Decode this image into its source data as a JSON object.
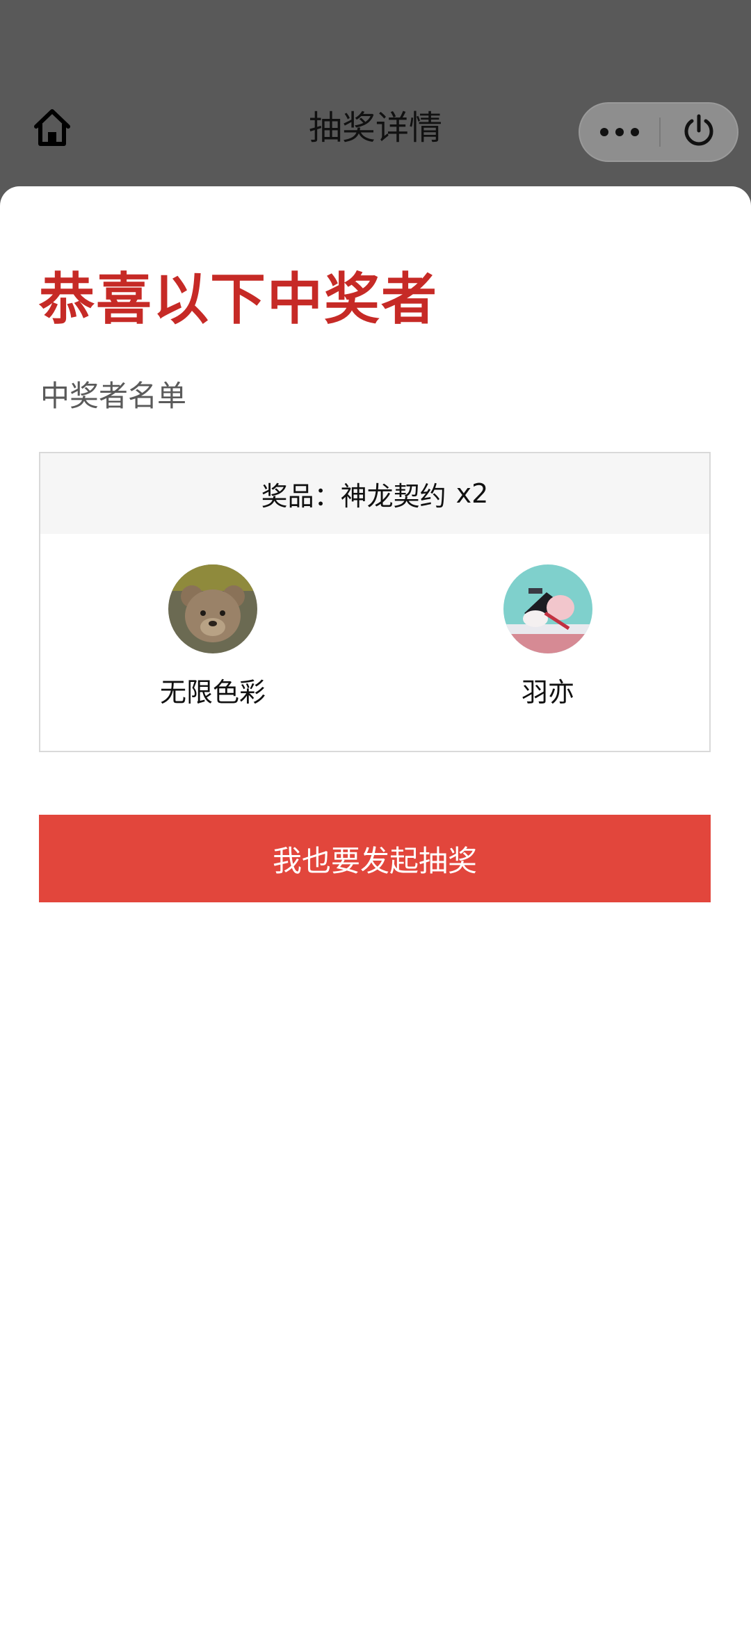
{
  "navbar": {
    "title": "抽奖详情",
    "home_icon": "home-icon",
    "more_icon": "more-dots-icon",
    "close_icon": "power-icon"
  },
  "main": {
    "headline": "恭喜以下中奖者",
    "section_label": "中奖者名单",
    "prize": {
      "label": "奖品：",
      "name": "神龙契约",
      "quantity": "x2",
      "winners": [
        {
          "name": "无限色彩",
          "avatar": "teddy-bear-avatar"
        },
        {
          "name": "羽亦",
          "avatar": "anime-character-avatar"
        }
      ]
    },
    "cta_label": "我也要发起抽奖"
  },
  "colors": {
    "headline": "#c62a26",
    "cta_background": "#e2463c",
    "overlay": "#595959"
  }
}
